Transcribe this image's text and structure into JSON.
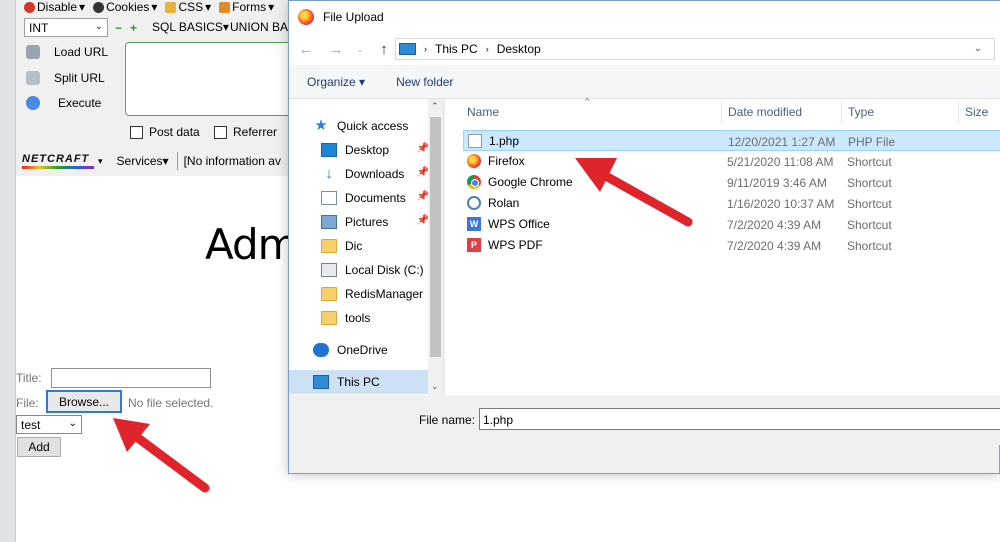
{
  "browser": {
    "toolbar": [
      {
        "label": "Disable",
        "icon": "disable-icon"
      },
      {
        "label": "Cookies",
        "icon": "cookie-icon"
      },
      {
        "label": "CSS",
        "icon": "css-icon"
      },
      {
        "label": "Forms",
        "icon": "forms-icon"
      }
    ]
  },
  "hackbar": {
    "select_value": "INT",
    "sql_menu": "SQL BASICS",
    "union_menu": "UNION BAS",
    "buttons": [
      "Load URL",
      "Split URL",
      "Execute"
    ],
    "post_data_label": "Post data",
    "referrer_label": "Referrer",
    "netcraft_logo": "NETCRAFT",
    "services_label": "Services",
    "info_text": "[No information av"
  },
  "page": {
    "heading": "Adm",
    "title_label": "Title:",
    "file_label": "File:",
    "browse_label": "Browse...",
    "no_file_text": "No file selected.",
    "select_value": "test",
    "add_label": "Add"
  },
  "dialog": {
    "title": "File Upload",
    "breadcrumb": [
      "This PC",
      "Desktop"
    ],
    "organize_label": "Organize",
    "new_folder_label": "New folder",
    "nav": {
      "quick_access": "Quick access",
      "items": [
        {
          "label": "Desktop",
          "icon": "desktop-icon",
          "pinned": true
        },
        {
          "label": "Downloads",
          "icon": "download-icon",
          "pinned": true
        },
        {
          "label": "Documents",
          "icon": "document-icon",
          "pinned": true
        },
        {
          "label": "Pictures",
          "icon": "picture-icon",
          "pinned": true
        },
        {
          "label": "Dic",
          "icon": "folder-icon",
          "pinned": false
        },
        {
          "label": "Local Disk (C:)",
          "icon": "drive-icon",
          "pinned": false
        },
        {
          "label": "RedisManager",
          "icon": "folder-icon",
          "pinned": false
        },
        {
          "label": "tools",
          "icon": "folder-icon",
          "pinned": false
        }
      ],
      "onedrive": "OneDrive",
      "this_pc": "This PC"
    },
    "columns": [
      "Name",
      "Date modified",
      "Type",
      "Size"
    ],
    "files": [
      {
        "name": "1.php",
        "date": "12/20/2021 1:27 AM",
        "type": "PHP File",
        "icon": "php-file-icon",
        "selected": true
      },
      {
        "name": "Firefox",
        "date": "5/21/2020 11:08 AM",
        "type": "Shortcut",
        "icon": "firefox-icon",
        "selected": false
      },
      {
        "name": "Google Chrome",
        "date": "9/11/2019 3:46 AM",
        "type": "Shortcut",
        "icon": "chrome-icon",
        "selected": false
      },
      {
        "name": "Rolan",
        "date": "1/16/2020 10:37 AM",
        "type": "Shortcut",
        "icon": "rolan-icon",
        "selected": false
      },
      {
        "name": "WPS Office",
        "date": "7/2/2020 4:39 AM",
        "type": "Shortcut",
        "icon": "wps-icon",
        "selected": false
      },
      {
        "name": "WPS PDF",
        "date": "7/2/2020 4:39 AM",
        "type": "Shortcut",
        "icon": "wps-pdf-icon",
        "selected": false
      }
    ],
    "file_name_label": "File name:",
    "file_name_value": "1.php"
  },
  "colors": {
    "selection": "#cce8ff",
    "annotation_arrow": "#e0242b",
    "browse_focus": "#2f7ad6"
  }
}
